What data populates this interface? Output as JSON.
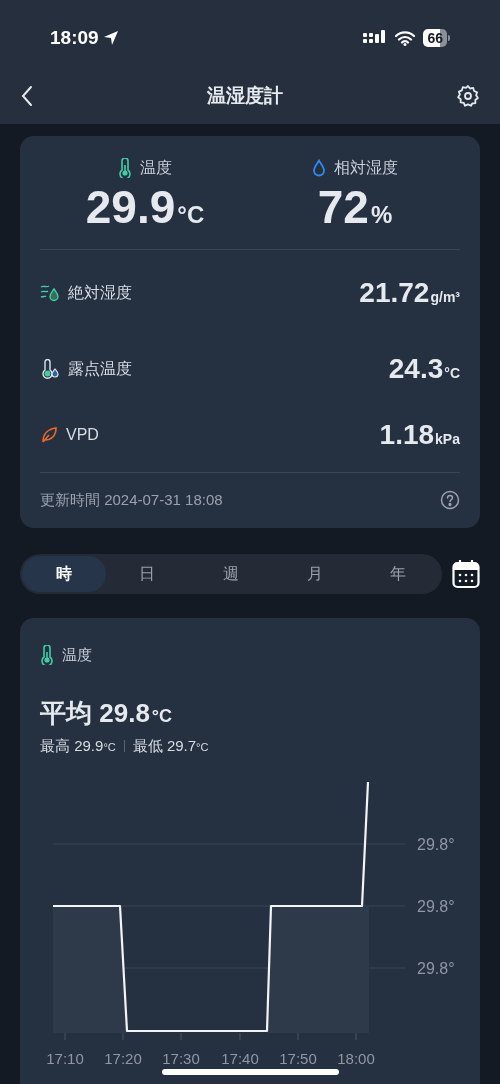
{
  "status_bar": {
    "time": "18:09",
    "battery": "66"
  },
  "header": {
    "title": "温湿度計"
  },
  "summary": {
    "primary": [
      {
        "kind": "thermometer",
        "label": "温度",
        "value": "29.9",
        "unit": "°C"
      },
      {
        "kind": "drop",
        "label": "相対湿度",
        "value": "72",
        "unit": "%"
      }
    ],
    "metrics": [
      {
        "kind": "wind-drop",
        "label": "絶対湿度",
        "value": "21.72",
        "unit": "g/m³"
      },
      {
        "kind": "dew",
        "label": "露点温度",
        "value": "24.3",
        "unit": "°C"
      },
      {
        "kind": "leaf",
        "label": "VPD",
        "value": "1.18",
        "unit": "kPa"
      }
    ],
    "updated": "更新時間 2024-07-31 18:08"
  },
  "tabs": [
    {
      "label": "時",
      "selected": true
    },
    {
      "label": "日",
      "selected": false
    },
    {
      "label": "週",
      "selected": false
    },
    {
      "label": "月",
      "selected": false
    },
    {
      "label": "年",
      "selected": false
    }
  ],
  "chart_card": {
    "title": "温度",
    "average_label": "平均",
    "average": "29.8",
    "unit": "°C",
    "stats": [
      {
        "label": "最高",
        "value": "29.9",
        "unit": "°C"
      },
      {
        "label": "最低",
        "value": "29.7",
        "unit": "°C"
      }
    ],
    "y_labels": [
      "29.8°",
      "29.8°",
      "29.8°"
    ],
    "x_labels": [
      "17:10",
      "17:20",
      "17:30",
      "17:40",
      "17:50",
      "18:00"
    ]
  }
}
